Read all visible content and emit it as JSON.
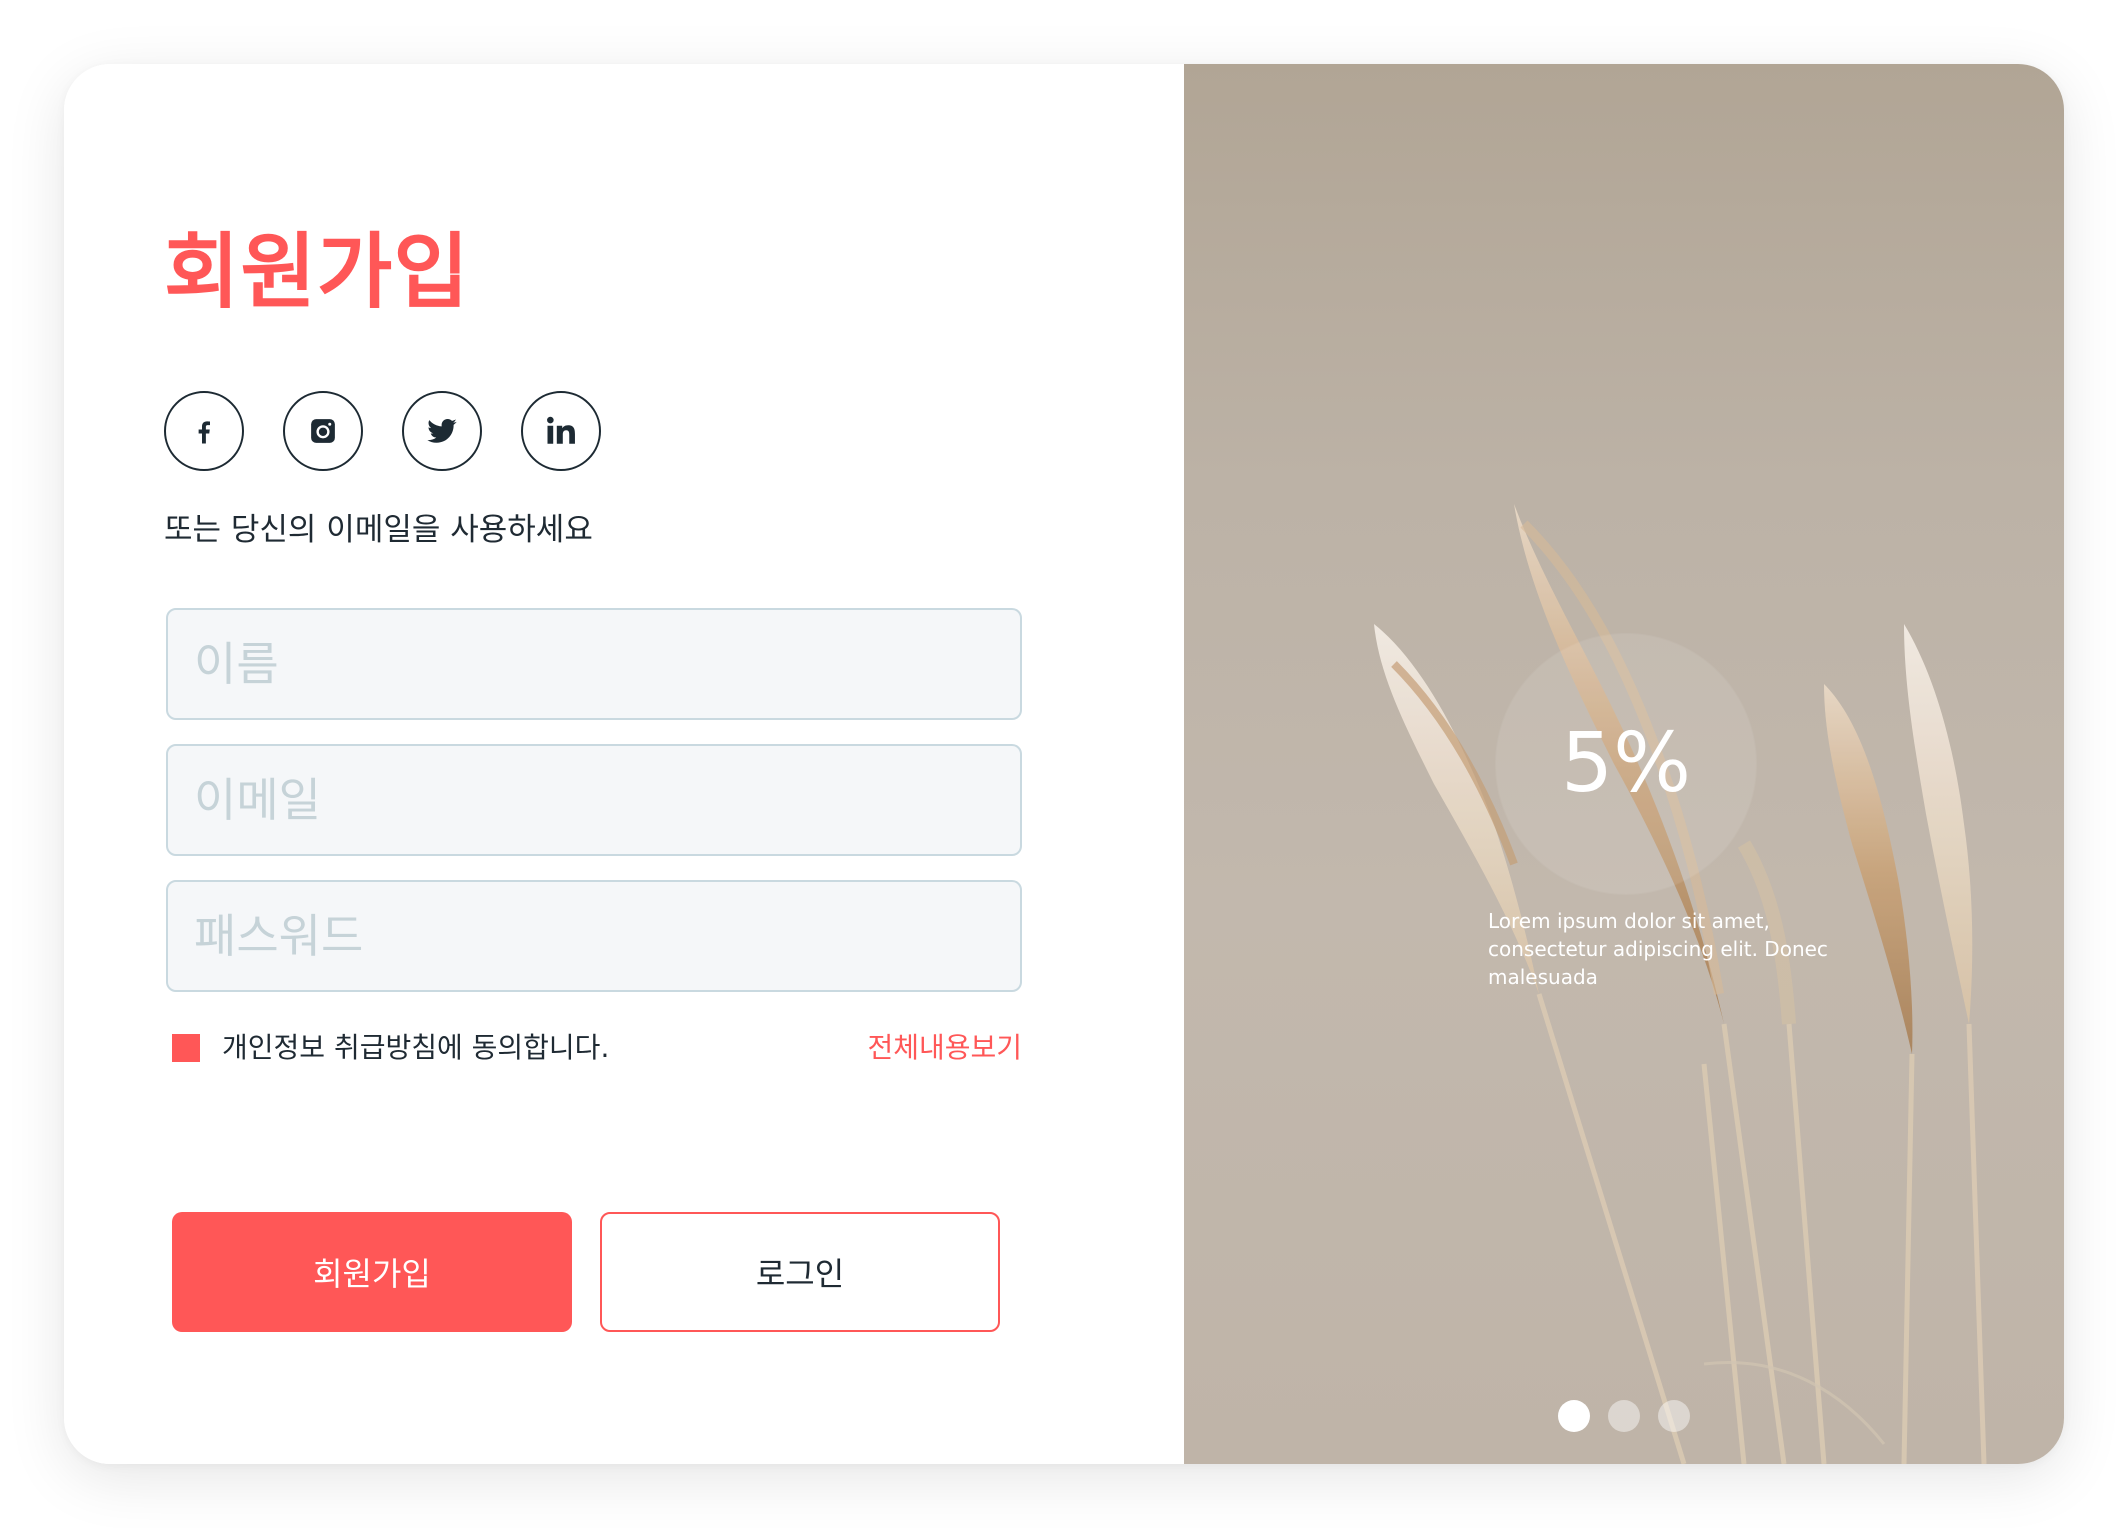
{
  "signup": {
    "title": "회원가입",
    "subtitle": "또는 당신의 이메일을 사용하세요",
    "social": [
      {
        "icon": "facebook-icon"
      },
      {
        "icon": "instagram-icon"
      },
      {
        "icon": "twitter-icon"
      },
      {
        "icon": "linkedin-icon"
      }
    ],
    "fields": {
      "name_placeholder": "이름",
      "email_placeholder": "이메일",
      "password_placeholder": "패스워드"
    },
    "agreement": {
      "label": "개인정보 취급방침에 동의합니다.",
      "view_all": "전체내용보기",
      "checked": true
    },
    "buttons": {
      "signup": "회원가입",
      "login": "로그인"
    }
  },
  "promo": {
    "progress_text": "5%",
    "progress_value": 5,
    "caption": "Lorem ipsum dolor sit amet, consectetur adipiscing elit. Donec malesuada",
    "slides": 3,
    "active_slide": 1
  },
  "colors": {
    "accent": "#ff5757",
    "text": "#1f2a33",
    "field_bg": "#f5f7f9",
    "field_border": "#c9d9e0"
  }
}
